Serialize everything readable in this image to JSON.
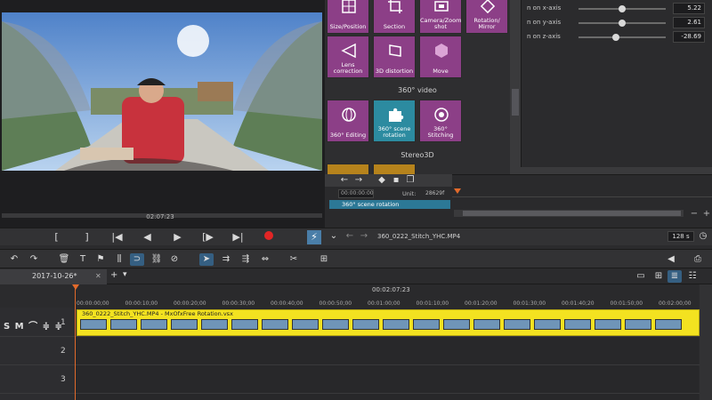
{
  "preview": {
    "timecode": "02:07:23",
    "transport": {
      "mark_in": "[",
      "mark_out": "]",
      "to_in": "|◀",
      "prev_frame": "◀",
      "play": "▶",
      "to_out": "[▶",
      "next_marker": "▶|",
      "flash": "⚡"
    }
  },
  "effects": {
    "tiles_top": [
      {
        "label": "Size/Position"
      },
      {
        "label": "Section"
      },
      {
        "label": "Camera/Zoom shot"
      },
      {
        "label": "Rotation/ Mirror"
      },
      {
        "label": "Lens correction"
      },
      {
        "label": "3D distortion"
      },
      {
        "label": "Move"
      }
    ],
    "section_360": "360° video",
    "tiles_360": [
      {
        "label": "360° Editing"
      },
      {
        "label": "360° scene rotation"
      },
      {
        "label": "360° Stitching"
      }
    ],
    "section_stereo": "Stereo3D"
  },
  "params": {
    "rows": [
      {
        "label": "n on x-axis",
        "value": "5.22",
        "fraction": 0.5
      },
      {
        "label": "n on y-axis",
        "value": "2.61",
        "fraction": 0.5
      },
      {
        "label": "n on z-axis",
        "value": "-28.69",
        "fraction": 0.42
      }
    ]
  },
  "keyframes": {
    "timecode": "00:00:00:00",
    "unit_label": "Unit:",
    "unit_value": "28629f",
    "row_label": "360° scene rotation"
  },
  "object": {
    "name": "360_0222_Stitch_YHC.MP4",
    "duration": "128 s"
  },
  "tabs": {
    "project": "2017-10-26*",
    "add": "+",
    "dropdown": "▾"
  },
  "timeline": {
    "center_time": "00:02:07:23",
    "ticks": [
      "00:00:00;00",
      "00:00:10;00",
      "00:00:20;00",
      "00:00:30;00",
      "00:00:40;00",
      "00:00:50;00",
      "00:01:00;00",
      "00:01:10;00",
      "00:01:20;00",
      "00:01:30;00",
      "00:01:40;20",
      "00:01:50;00",
      "00:02:00;00"
    ],
    "track1_controls": "S M ⌒ ≑ ≑",
    "tracks": [
      "1",
      "2",
      "3"
    ],
    "clip_title": "360_0222_Stitch_YHC.MP4 - MxOfxFree Rotation.vsx"
  },
  "colors": {
    "accent_blue": "#2c8ba0",
    "tile_purple": "#8c3f87",
    "clip_yellow": "#f3e220",
    "record_red": "#e22525",
    "playhead_orange": "#e26a2b"
  }
}
